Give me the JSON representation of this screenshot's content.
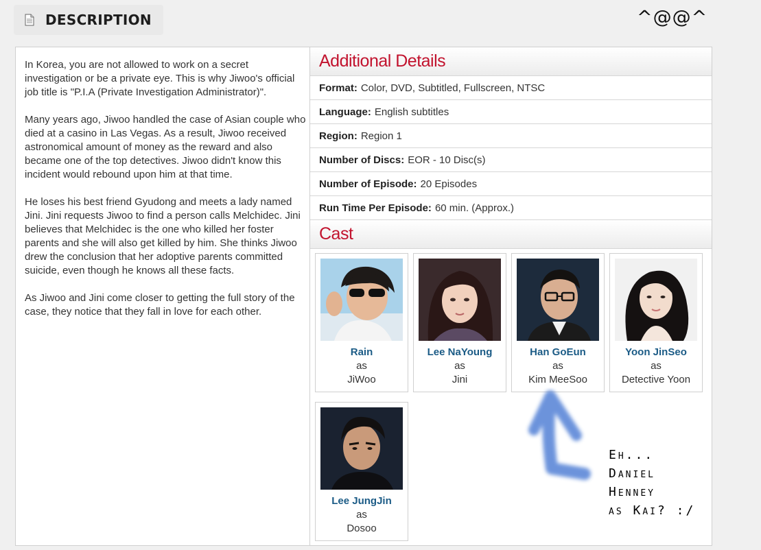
{
  "header": {
    "title": "DESCRIPTION",
    "icon": "document-icon"
  },
  "emoticon": "^@@^",
  "synopsis": [
    "In Korea, you are not allowed to work on a secret investigation or be a private eye. This is why Jiwoo's official job title is \"P.I.A (Private Investigation Administrator)\".",
    "Many years ago, Jiwoo handled the case of Asian couple who died at a casino in Las Vegas. As a result, Jiwoo received astronomical amount of money as the reward and also became one of the top detectives. Jiwoo didn't know this incident would rebound upon him at that time.",
    "He loses his best friend Gyudong and meets a lady named Jini. Jini requests Jiwoo to find a person calls Melchidec. Jini believes that Melchidec is the one who killed her foster parents and she will also get killed by him. She thinks Jiwoo drew the conclusion that her adoptive parents committed suicide, even though he knows all these facts.",
    "As Jiwoo and Jini come closer to getting the full story of the case, they notice that they fall in love for each other."
  ],
  "details": {
    "title": "Additional Details",
    "rows": [
      {
        "label": "Format:",
        "value": "Color, DVD, Subtitled, Fullscreen, NTSC"
      },
      {
        "label": "Language:",
        "value": "English subtitles"
      },
      {
        "label": "Region:",
        "value": "Region 1"
      },
      {
        "label": "Number of Discs:",
        "value": "EOR - 10 Disc(s)"
      },
      {
        "label": "Number of Episode:",
        "value": "20 Episodes"
      },
      {
        "label": "Run Time Per Episode:",
        "value": "60 min. (Approx.)"
      }
    ]
  },
  "cast": {
    "title": "Cast",
    "members": [
      {
        "name": "Rain",
        "as": "as",
        "role": "JiWoo"
      },
      {
        "name": "Lee NaYoung",
        "as": "as",
        "role": "Jini"
      },
      {
        "name": "Han GoEun",
        "as": "as",
        "role": "Kim MeeSoo"
      },
      {
        "name": "Yoon JinSeo",
        "as": "as",
        "role": "Detective Yoon"
      },
      {
        "name": "Lee JungJin",
        "as": "as",
        "role": "Dosoo"
      }
    ]
  },
  "annotation": {
    "lines": [
      "Eh...",
      "Daniel",
      "Henney",
      "as Kai? :/"
    ],
    "arrow_color": "#3a6fd0"
  },
  "colors": {
    "accent": "#c2132e",
    "cast_name": "#1b5b86"
  }
}
